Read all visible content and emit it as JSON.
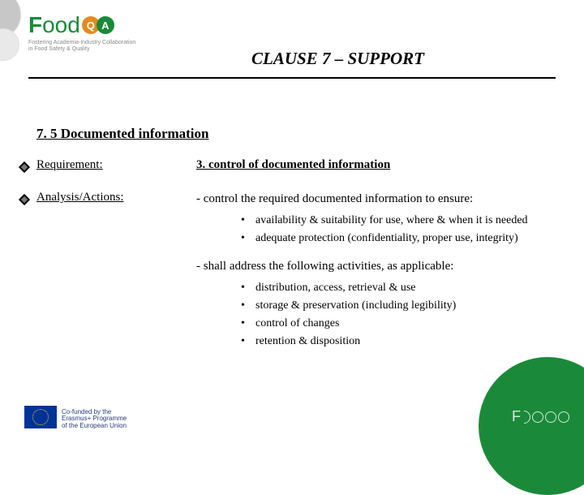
{
  "logo": {
    "text_f": "F",
    "text_oo": "oo",
    "text_d": "d",
    "badge_q": "Q",
    "badge_a": "A",
    "tagline_l1": "Fostering Academia-Industry Collaboration",
    "tagline_l2": "in Food Safety & Quality"
  },
  "title": "CLAUSE 7 – SUPPORT",
  "section": "7. 5 Documented information",
  "labels": {
    "requirement": "Requirement:",
    "analysis": "Analysis/Actions:"
  },
  "content": {
    "heading": "3. control of documented information",
    "lead1": "- control the required documented information to ensure:",
    "bullets1": [
      "availability & suitability for use, where & when it is needed",
      "adequate protection (confidentiality, proper use, integrity)"
    ],
    "lead2": "- shall address the following activities, as applicable:",
    "bullets2": [
      "distribution, access, retrieval & use",
      "storage & preservation (including legibility)",
      "control of changes",
      "retention & disposition"
    ]
  },
  "footer": {
    "l1": "Co-funded by the",
    "l2": "Erasmus+ Programme",
    "l3": "of the European Union"
  }
}
